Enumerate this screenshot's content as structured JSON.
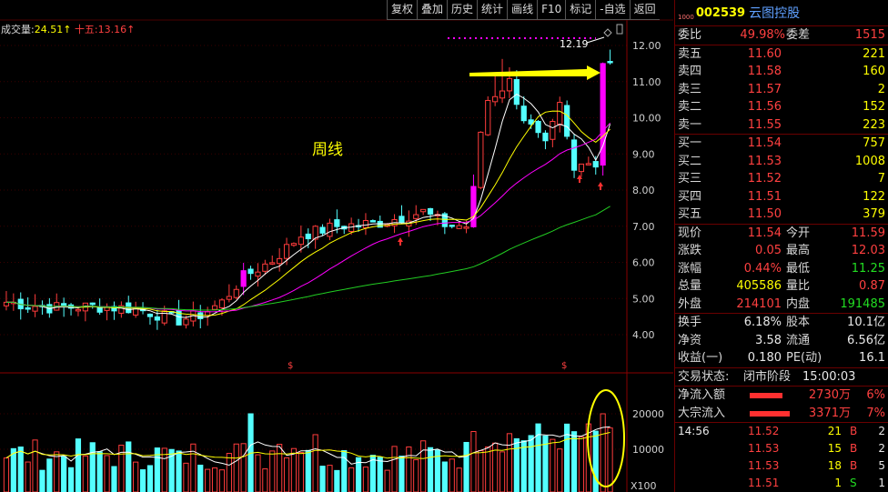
{
  "toolbar": [
    "复权",
    "叠加",
    "历史",
    "统计",
    "画线",
    "F10",
    "标记",
    "-自选",
    "返回"
  ],
  "volume_info": {
    "label": "成交量:",
    "value": "24.51",
    "ma_label": "十五:",
    "ma_value": "13.16"
  },
  "annotation": {
    "label": "周线"
  },
  "price_axis": [
    "12.00",
    "11.00",
    "10.00",
    "9.00",
    "8.00",
    "7.00",
    "6.00",
    "5.00",
    "4.00"
  ],
  "volume_axis": [
    "20000",
    "10000",
    "X100"
  ],
  "high_marker": "12.19",
  "stock": {
    "level": "1000",
    "code": "002539",
    "name": "云图控股"
  },
  "weibi": {
    "label": "委比",
    "value": "49.98%",
    "label2": "委差",
    "value2": "1515"
  },
  "sells": [
    {
      "label": "卖五",
      "price": "11.60",
      "vol": "221"
    },
    {
      "label": "卖四",
      "price": "11.58",
      "vol": "160"
    },
    {
      "label": "卖三",
      "price": "11.57",
      "vol": "2"
    },
    {
      "label": "卖二",
      "price": "11.56",
      "vol": "152"
    },
    {
      "label": "卖一",
      "price": "11.55",
      "vol": "223"
    }
  ],
  "buys": [
    {
      "label": "买一",
      "price": "11.54",
      "vol": "757"
    },
    {
      "label": "买二",
      "price": "11.53",
      "vol": "1008"
    },
    {
      "label": "买三",
      "price": "11.52",
      "vol": "7"
    },
    {
      "label": "买四",
      "price": "11.51",
      "vol": "122"
    },
    {
      "label": "买五",
      "price": "11.50",
      "vol": "379"
    }
  ],
  "stats": [
    {
      "l1": "现价",
      "v1": "11.54",
      "l2": "今开",
      "v2": "11.59"
    },
    {
      "l1": "涨跌",
      "v1": "0.05",
      "l2": "最高",
      "v2": "12.03"
    },
    {
      "l1": "涨幅",
      "v1": "0.44%",
      "l2": "最低",
      "v2": "11.25"
    },
    {
      "l1": "总量",
      "v1": "405586",
      "l2": "量比",
      "v2": "0.87"
    },
    {
      "l1": "外盘",
      "v1": "214101",
      "l2": "内盘",
      "v2": "191485"
    }
  ],
  "fundamentals": [
    {
      "l1": "换手",
      "v1": "6.18%",
      "l2": "股本",
      "v2": "10.1亿"
    },
    {
      "l1": "净资",
      "v1": "3.58",
      "l2": "流通",
      "v2": "6.56亿"
    },
    {
      "l1": "收益(一)",
      "v1": "0.180",
      "l2": "PE(动)",
      "v2": "16.1"
    }
  ],
  "trade_status": {
    "label": "交易状态:",
    "value": "闭市阶段",
    "time": "15:00:03"
  },
  "flows": [
    {
      "label": "净流入额",
      "value": "2730万",
      "pct": "6%",
      "bar": 0.45
    },
    {
      "label": "大宗流入",
      "value": "3371万",
      "pct": "7%",
      "bar": 0.55
    }
  ],
  "ticks": [
    {
      "time": "14:56",
      "price": "11.52",
      "vol": "21",
      "side": "B",
      "n": "2"
    },
    {
      "time": "",
      "price": "11.53",
      "vol": "15",
      "side": "B",
      "n": "2"
    },
    {
      "time": "",
      "price": "11.53",
      "vol": "18",
      "side": "B",
      "n": "5"
    },
    {
      "time": "",
      "price": "11.51",
      "vol": "1",
      "side": "S",
      "n": "1"
    }
  ],
  "colors": {
    "up": "#ff3c3c",
    "down": "#54ffff",
    "limit": "#ff00ff",
    "ma5": "#ffffff",
    "ma10": "#ffff00",
    "ma20": "#ff00ff",
    "ma60": "#22cc22"
  }
}
